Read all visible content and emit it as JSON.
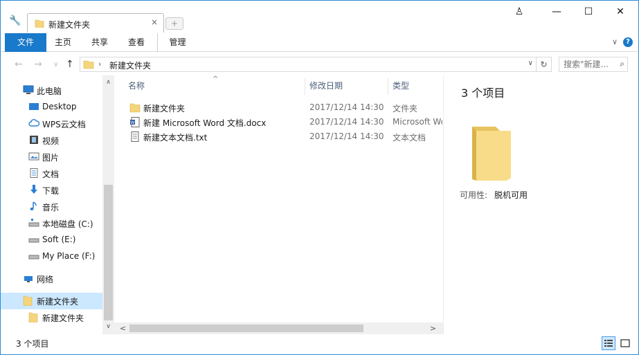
{
  "titlebar": {
    "tab_label": "新建文件夹",
    "tab_close": "×",
    "new_tab": "+",
    "wrench": "🔧",
    "window_buttons": {
      "user": "♙",
      "minimize": "—",
      "maximize": "☐",
      "close": "✕"
    }
  },
  "ribbon": {
    "tabs": [
      "文件",
      "主页",
      "共享",
      "查看",
      "管理"
    ],
    "expand": "∨",
    "help": "?"
  },
  "nav": {
    "back": "←",
    "forward": "→",
    "recent": "∨",
    "up": "↑",
    "address_path": "新建文件夹",
    "address_sep": "›",
    "address_dropdown": "∨",
    "refresh": "↻",
    "search_placeholder": "搜索\"新建...",
    "search_icon": "⌕"
  },
  "sidebar": {
    "items": [
      {
        "label": "此电脑",
        "icon": "pc-icon"
      },
      {
        "label": "Desktop",
        "icon": "desktop-icon"
      },
      {
        "label": "WPS云文档",
        "icon": "cloud-icon"
      },
      {
        "label": "视频",
        "icon": "video-icon"
      },
      {
        "label": "图片",
        "icon": "picture-icon"
      },
      {
        "label": "文档",
        "icon": "document-icon"
      },
      {
        "label": "下载",
        "icon": "download-icon"
      },
      {
        "label": "音乐",
        "icon": "music-icon"
      },
      {
        "label": "本地磁盘 (C:)",
        "icon": "drive-c-icon"
      },
      {
        "label": "Soft (E:)",
        "icon": "drive-icon"
      },
      {
        "label": "My Place (F:)",
        "icon": "drive-icon"
      },
      {
        "label": "网络",
        "icon": "network-icon"
      },
      {
        "label": "新建文件夹",
        "icon": "folder-icon"
      },
      {
        "label": "新建文件夹",
        "icon": "folder-icon"
      }
    ],
    "scroll_up": "∧",
    "scroll_down": "∨"
  },
  "filelist": {
    "columns": {
      "name": "名称",
      "date": "修改日期",
      "type": "类型"
    },
    "sort_indicator": "^",
    "rows": [
      {
        "name": "新建文件夹",
        "date": "2017/12/14 14:30",
        "type": "文件夹",
        "icon": "folder-icon"
      },
      {
        "name": "新建 Microsoft Word 文档.docx",
        "date": "2017/12/14 14:30",
        "type": "Microsoft Word",
        "icon": "word-doc-icon"
      },
      {
        "name": "新建文本文档.txt",
        "date": "2017/12/14 14:30",
        "type": "文本文档",
        "icon": "text-file-icon"
      }
    ],
    "hscroll_left": "<",
    "hscroll_right": ">"
  },
  "preview": {
    "count": "3 个项目",
    "availability_label": "可用性:",
    "availability_value": "脱机可用"
  },
  "status": {
    "text": "3 个项目"
  },
  "colors": {
    "accent": "#1979ca",
    "selection": "#cce8ff",
    "folder": "#f5d57c",
    "border": "#2b8ad8"
  }
}
